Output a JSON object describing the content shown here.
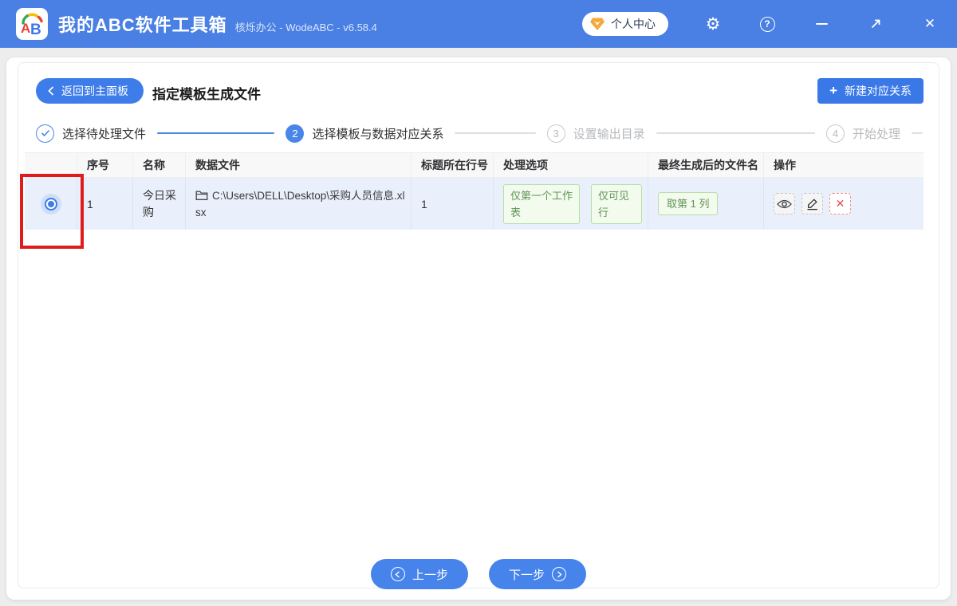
{
  "titlebar": {
    "logo_text": "AB",
    "app_title": "我的ABC软件工具箱",
    "subtitle": "核烁办公 - WodeABC - v6.58.4",
    "user_center_label": "个人中心",
    "gear_glyph": "⚙",
    "help_glyph": "?",
    "close_glyph": "✕"
  },
  "header": {
    "back_label": "返回到主面板",
    "page_title": "指定模板生成文件",
    "plus_glyph": "+",
    "new_relation_label": "新建对应关系"
  },
  "steps": [
    {
      "num": "✓",
      "label": "选择待处理文件",
      "state": "done"
    },
    {
      "num": "2",
      "label": "选择模板与数据对应关系",
      "state": "active"
    },
    {
      "num": "3",
      "label": "设置输出目录",
      "state": "pending"
    },
    {
      "num": "4",
      "label": "开始处理",
      "state": "pending"
    }
  ],
  "table": {
    "headers": [
      "",
      "序号",
      "名称",
      "数据文件",
      "标题所在行号",
      "处理选项",
      "最终生成后的文件名",
      "操作"
    ],
    "row": {
      "index": "1",
      "name": "今日采购",
      "data_file": "C:\\Users\\DELL\\Desktop\\采购人员信息.xlsx",
      "title_row": "1",
      "options": [
        "仅第一个工作表",
        "仅可见行"
      ],
      "filename_rule": "取第 1 列",
      "delete_glyph": "✕"
    }
  },
  "footer": {
    "prev_label": "上一步",
    "next_label": "下一步"
  },
  "colors": {
    "titlebar_blue": "#4a80e4",
    "accent_blue": "#3e7de9",
    "step_blue": "#4a86e8",
    "row_highlight": "#e9f0fb",
    "tag_green_border": "#b5dfa2",
    "tag_green_bg": "#f3faee",
    "tag_green_text": "#5f9454",
    "danger_red": "#e84c4c",
    "annotation_red": "#de1c1c"
  }
}
